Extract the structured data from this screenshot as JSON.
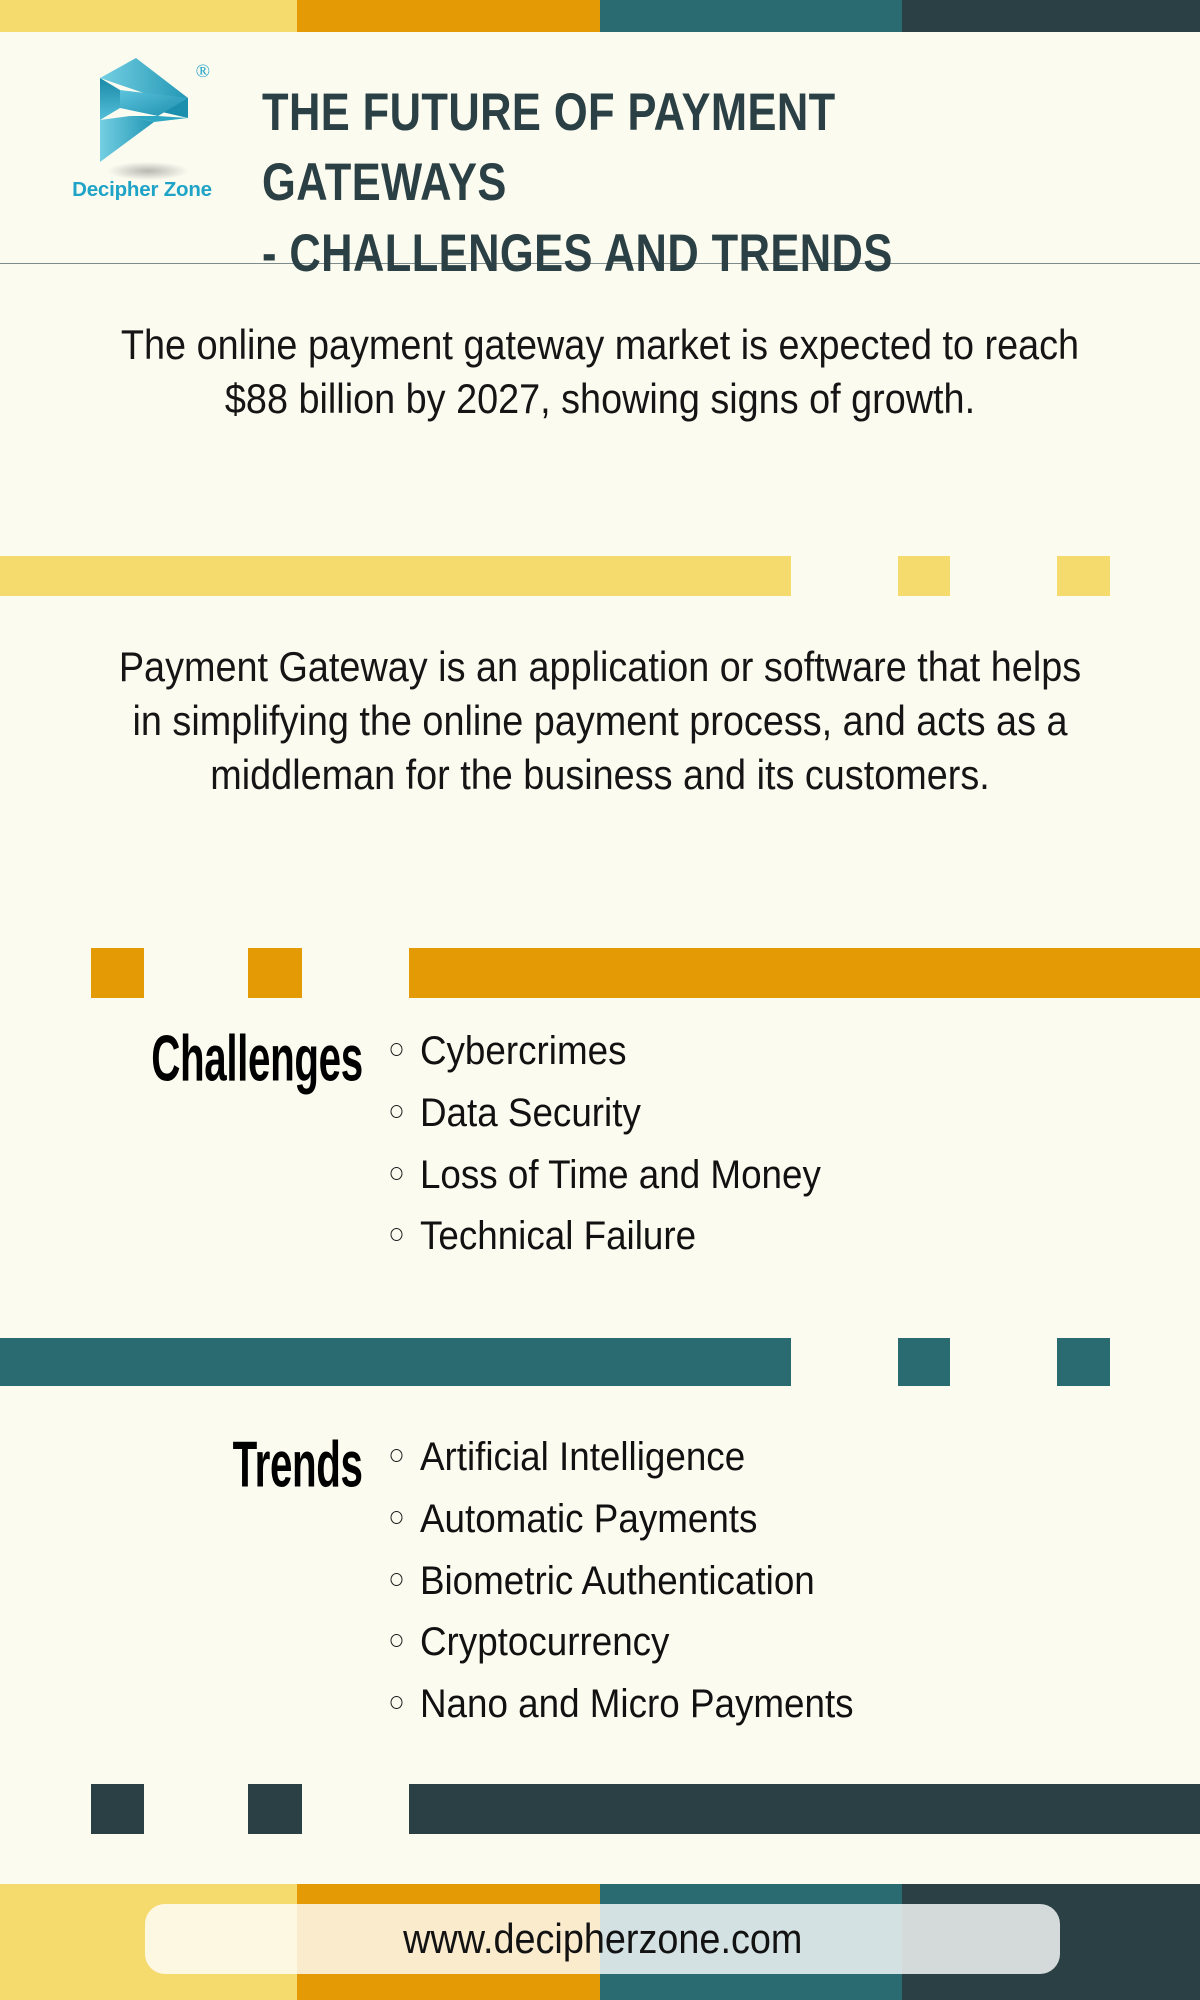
{
  "brand": {
    "logo_icon": "decipher-zone-chevron-logo",
    "logo_name": "Decipher Zone",
    "registered_mark": "®",
    "accent_logo_color": "#1FA3C6"
  },
  "palette": {
    "background": "#FCFBF0",
    "yellow": "#F5DA6E",
    "orange": "#E39A05",
    "teal": "#2A6B72",
    "dark": "#2B4044"
  },
  "header": {
    "title_line1": "THE FUTURE OF PAYMENT GATEWAYS",
    "title_line2": "- CHALLENGES AND TRENDS"
  },
  "body": {
    "paragraph1": "The online payment gateway market is expected to reach $88 billion by 2027, showing signs of growth.",
    "paragraph2": "Payment Gateway is an application or software that helps in simplifying the online payment process, and acts as a middleman for the business and its customers."
  },
  "sections": [
    {
      "heading": "Challenges",
      "accent": "#E39A05",
      "items": [
        "Cybercrimes",
        "Data Security",
        "Loss of Time and Money",
        "Technical Failure"
      ]
    },
    {
      "heading": "Trends",
      "accent": "#2A6B72",
      "items": [
        "Artificial Intelligence",
        "Automatic Payments",
        "Biometric Authentication",
        "Cryptocurrency",
        "Nano and Micro Payments"
      ]
    }
  ],
  "footer": {
    "url": "www.decipherzone.com"
  }
}
